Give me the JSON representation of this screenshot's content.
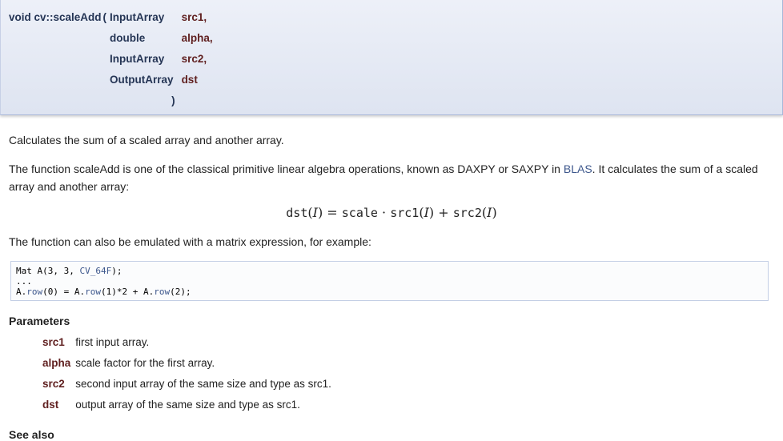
{
  "signature": {
    "return_and_name": "void cv::scaleAdd",
    "open_paren": "(",
    "close_paren": ")",
    "params": [
      {
        "type": "InputArray",
        "name": "src1,"
      },
      {
        "type": "double",
        "name": "alpha,"
      },
      {
        "type": "InputArray",
        "name": "src2,"
      },
      {
        "type": "OutputArray",
        "name": "dst"
      }
    ]
  },
  "description": {
    "brief": "Calculates the sum of a scaled array and another array.",
    "detail_before_link": "The function scaleAdd is one of the classical primitive linear algebra operations, known as DAXPY or SAXPY in",
    "link": "BLAS",
    "detail_after_link": ". It calculates the sum of a scaled",
    "detail_line2": "array and another array:",
    "formula": {
      "lhs_fn": "dst",
      "arg": "I",
      "eq": "=",
      "scale": "scale",
      "dot": "·",
      "src1": "src1",
      "plus": "+",
      "src2": "src2"
    },
    "emulate_text": "The function can also be emulated with a matrix expression, for example:"
  },
  "code": {
    "line1_a": "Mat A(3, 3, ",
    "line1_kw": "CV_64F",
    "line1_b": ");",
    "line2": "...",
    "line3_a": "A.",
    "line3_kw1": "row",
    "line3_b": "(0) = A.",
    "line3_kw2": "row",
    "line3_c": "(1)*2 + A.",
    "line3_kw3": "row",
    "line3_d": "(2);"
  },
  "parameters": {
    "heading": "Parameters",
    "items": [
      {
        "name": "src1",
        "desc": "first input array."
      },
      {
        "name": "alpha",
        "desc": "scale factor for the first array."
      },
      {
        "name": "src2",
        "desc": "second input array of the same size and type as src1."
      },
      {
        "name": "dst",
        "desc": "output array of the same size and type as src1."
      }
    ]
  },
  "see_also": "See also",
  "colors": {
    "signature_bg": "#e3e8f4",
    "param_name": "#602020",
    "link": "#3d578c"
  }
}
